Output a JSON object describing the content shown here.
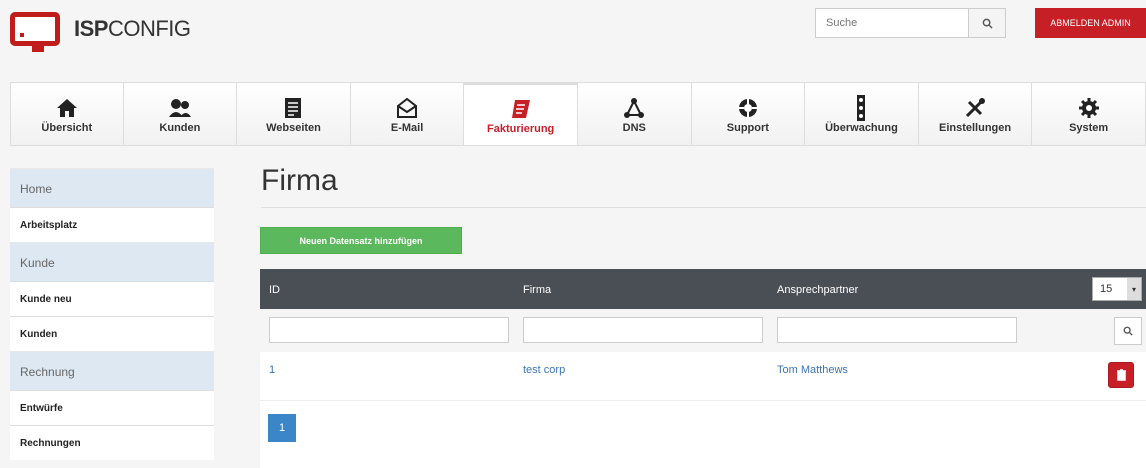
{
  "app": {
    "brand_bold": "ISP",
    "brand_light": "CONFIG"
  },
  "search": {
    "placeholder": "Suche"
  },
  "logout_label": "ABMELDEN ADMIN",
  "nav": [
    {
      "label": "Übersicht",
      "icon": "home-icon"
    },
    {
      "label": "Kunden",
      "icon": "users-icon"
    },
    {
      "label": "Webseiten",
      "icon": "document-icon"
    },
    {
      "label": "E-Mail",
      "icon": "mail-icon"
    },
    {
      "label": "Fakturierung",
      "icon": "invoice-icon",
      "active": true
    },
    {
      "label": "DNS",
      "icon": "dns-icon"
    },
    {
      "label": "Support",
      "icon": "lifebuoy-icon"
    },
    {
      "label": "Überwachung",
      "icon": "traffic-light-icon"
    },
    {
      "label": "Einstellungen",
      "icon": "tools-icon"
    },
    {
      "label": "System",
      "icon": "gear-icon"
    }
  ],
  "sidebar": {
    "home": "Home",
    "arbeitsplatz": "Arbeitsplatz",
    "kunde": "Kunde",
    "kunde_neu": "Kunde neu",
    "kunden": "Kunden",
    "rechnung": "Rechnung",
    "entwurfe": "Entwürfe",
    "rechnungen": "Rechnungen"
  },
  "page": {
    "title": "Firma",
    "add_button": "Neuen Datensatz hinzufügen"
  },
  "table": {
    "headers": [
      "ID",
      "Firma",
      "Ansprechpartner"
    ],
    "page_size": "15",
    "rows": [
      {
        "id": "1",
        "firma": "test corp",
        "contact": "Tom Matthews"
      }
    ],
    "pages": [
      "1"
    ]
  },
  "colors": {
    "accent": "#c62026",
    "button_green": "#5cb85c",
    "link_blue": "#3c75b3"
  }
}
